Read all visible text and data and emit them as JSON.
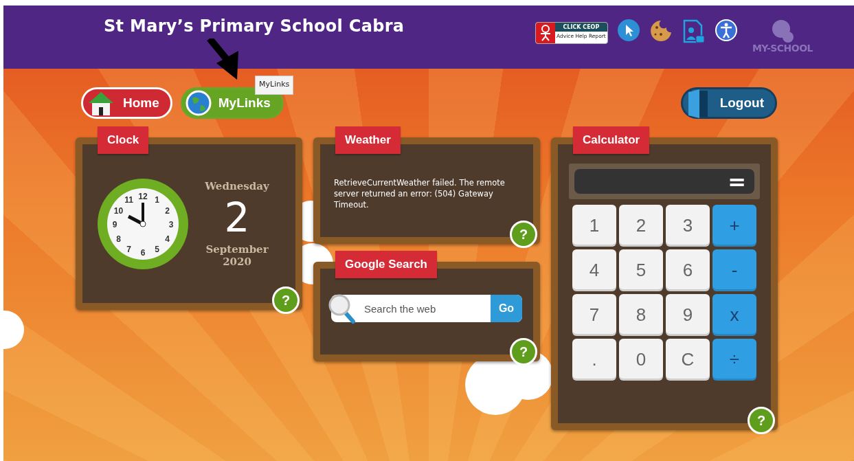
{
  "header": {
    "title": "St Mary’s Primary School Cabra",
    "ceop_badge": {
      "title": "CLICK CEOP",
      "subtitle": "Advice Help Report"
    },
    "logo_text": "MY-SCHOOL"
  },
  "nav": {
    "buttons": [
      {
        "label": "Home",
        "kind": "home"
      },
      {
        "label": "MyLinks",
        "kind": "links"
      }
    ],
    "tooltip": "MyLinks",
    "logout": "Logout"
  },
  "clock": {
    "title": "Clock",
    "dial_numbers": [
      "12",
      "11",
      "1",
      "10",
      "2",
      "9",
      "3",
      "8",
      "4",
      "7",
      "5",
      "6"
    ],
    "weekday": "Wednesday",
    "day": "2",
    "month": "September",
    "year": "2020",
    "help": "?"
  },
  "weather": {
    "title": "Weather",
    "message": "RetrieveCurrentWeather failed. The remote server returned an error: (504) Gateway Timeout.",
    "help": "?"
  },
  "search": {
    "title": "Google Search",
    "placeholder": "Search the web",
    "button": "Go",
    "help": "?"
  },
  "calculator": {
    "title": "Calculator",
    "display_symbol": "=",
    "help": "?",
    "keys": [
      {
        "label": "1",
        "kind": "digit"
      },
      {
        "label": "2",
        "kind": "digit"
      },
      {
        "label": "3",
        "kind": "digit"
      },
      {
        "label": "+",
        "kind": "operator"
      },
      {
        "label": "4",
        "kind": "digit"
      },
      {
        "label": "5",
        "kind": "digit"
      },
      {
        "label": "6",
        "kind": "digit"
      },
      {
        "label": "-",
        "kind": "operator"
      },
      {
        "label": "7",
        "kind": "digit"
      },
      {
        "label": "8",
        "kind": "digit"
      },
      {
        "label": "9",
        "kind": "digit"
      },
      {
        "label": "x",
        "kind": "operator"
      },
      {
        "label": ".",
        "kind": "digit"
      },
      {
        "label": "0",
        "kind": "digit"
      },
      {
        "label": "C",
        "kind": "digit"
      },
      {
        "label": "÷",
        "kind": "operator"
      }
    ]
  }
}
